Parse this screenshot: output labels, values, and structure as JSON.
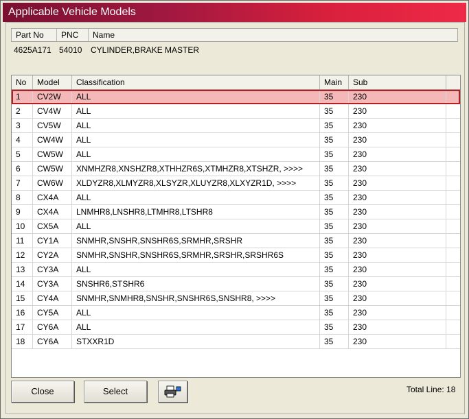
{
  "window": {
    "title": "Applicable Vehicle Models"
  },
  "part": {
    "headers": [
      "Part No",
      "PNC",
      "Name"
    ],
    "values": [
      "4625A171",
      "54010",
      "CYLINDER,BRAKE MASTER"
    ]
  },
  "grid": {
    "headers": [
      "No",
      "Model",
      "Classification",
      "Main",
      "Sub"
    ],
    "rows": [
      [
        "1",
        "CV2W",
        "ALL",
        "35",
        "230"
      ],
      [
        "2",
        "CV4W",
        "ALL",
        "35",
        "230"
      ],
      [
        "3",
        "CV5W",
        "ALL",
        "35",
        "230"
      ],
      [
        "4",
        "CW4W",
        "ALL",
        "35",
        "230"
      ],
      [
        "5",
        "CW5W",
        "ALL",
        "35",
        "230"
      ],
      [
        "6",
        "CW5W",
        "XNMHZR8,XNSHZR8,XTHHZR6S,XTMHZR8,XTSHZR,  >>>>",
        "35",
        "230"
      ],
      [
        "7",
        "CW6W",
        "XLDYZR8,XLMYZR8,XLSYZR,XLUYZR8,XLXYZR1D,  >>>>",
        "35",
        "230"
      ],
      [
        "8",
        "CX4A",
        "ALL",
        "35",
        "230"
      ],
      [
        "9",
        "CX4A",
        "LNMHR8,LNSHR8,LTMHR8,LTSHR8",
        "35",
        "230"
      ],
      [
        "10",
        "CX5A",
        "ALL",
        "35",
        "230"
      ],
      [
        "11",
        "CY1A",
        "SNMHR,SNSHR,SNSHR6S,SRMHR,SRSHR",
        "35",
        "230"
      ],
      [
        "12",
        "CY2A",
        "SNMHR,SNSHR,SNSHR6S,SRMHR,SRSHR,SRSHR6S",
        "35",
        "230"
      ],
      [
        "13",
        "CY3A",
        "ALL",
        "35",
        "230"
      ],
      [
        "14",
        "CY3A",
        "SNSHR6,STSHR6",
        "35",
        "230"
      ],
      [
        "15",
        "CY4A",
        "SNMHR,SNMHR8,SNSHR,SNSHR6S,SNSHR8,  >>>>",
        "35",
        "230"
      ],
      [
        "16",
        "CY5A",
        "ALL",
        "35",
        "230"
      ],
      [
        "17",
        "CY6A",
        "ALL",
        "35",
        "230"
      ],
      [
        "18",
        "CY6A",
        "STXXR1D",
        "35",
        "230"
      ]
    ],
    "selected_row": 0
  },
  "buttons": {
    "close": "Close",
    "select": "Select",
    "print_icon": "printer-icon"
  },
  "footer": {
    "total_line": "Total Line: 18"
  },
  "colors": {
    "title_start": "#7a1030",
    "title_end": "#ee2a48",
    "selected_row": "#f5b8b8",
    "selected_border": "#b02020"
  }
}
